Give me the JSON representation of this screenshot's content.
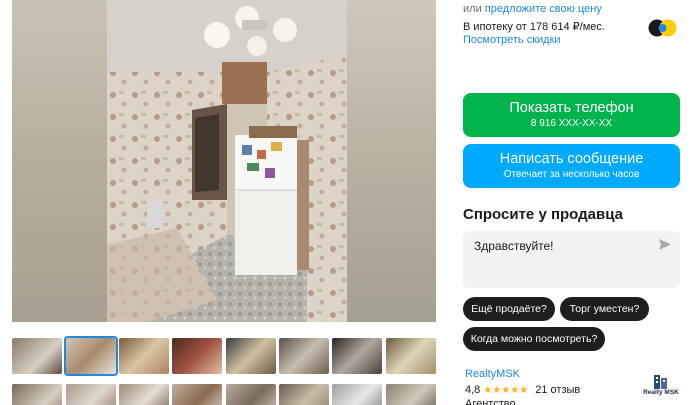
{
  "price": {
    "alt_prefix": "или",
    "offer_link": "предложите свою цену",
    "mortgage": "В ипотеку от 178 614 ₽/мес.",
    "discounts_link": "Посмотреть скидки"
  },
  "contact": {
    "phone_label": "Показать телефон",
    "phone_masked": "8 916 XXX-XX-XX",
    "message_label": "Написать сообщение",
    "message_sub": "Отвечает за несколько часов"
  },
  "ask": {
    "title": "Спросите у продавца",
    "input_value": "Здравствуйте!",
    "quick_questions": [
      "Ещё продаёте?",
      "Торг уместен?",
      "Когда можно посмотреть?"
    ]
  },
  "seller": {
    "name": "RealtyMSK",
    "rating": "4,8",
    "stars": "★★★★★",
    "reviews": "21 отзыв",
    "type": "Агентство",
    "logo_text": "Realty MSK"
  },
  "gallery": {
    "thumbnail_count": 16,
    "active_index": 1
  },
  "colors": {
    "phone_button": "#00b34a",
    "message_button": "#00aaff",
    "link": "#1e88e5",
    "chip": "#1e1e1e",
    "star": "#ffb021"
  },
  "icons": [
    "send-icon",
    "bank-logo-icon",
    "agency-logo-icon"
  ]
}
